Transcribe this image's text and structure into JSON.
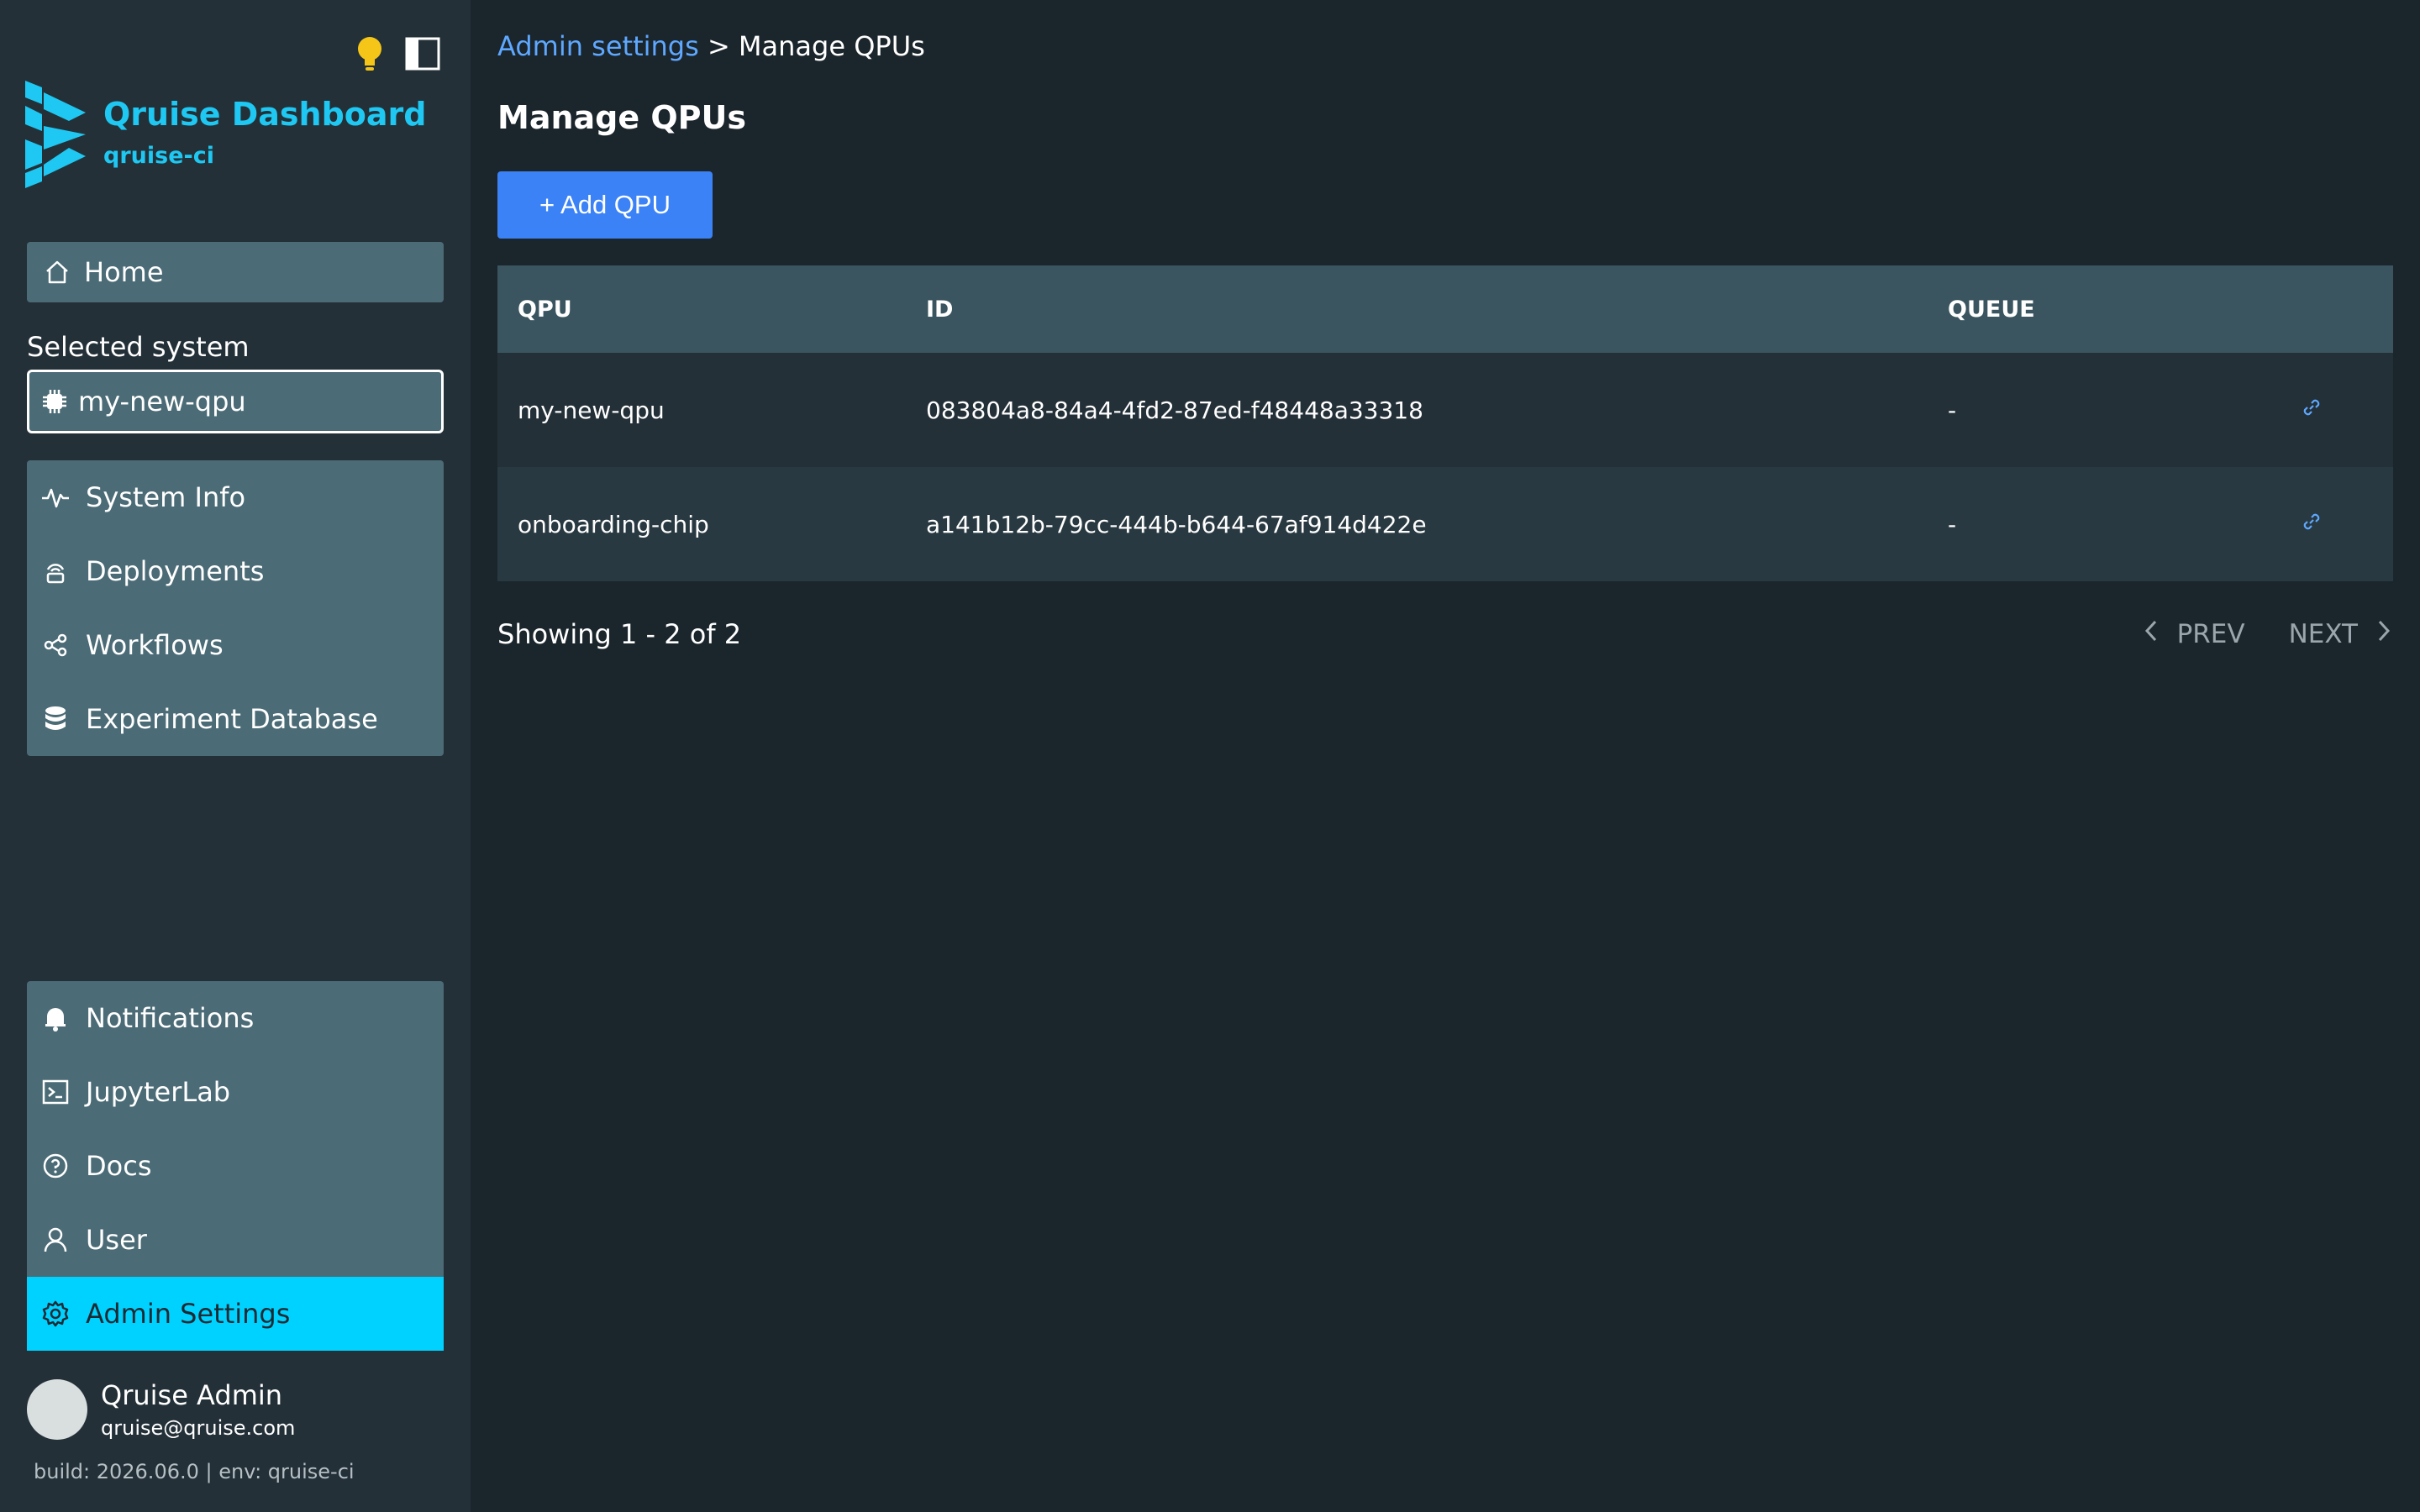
{
  "app": {
    "title": "Qruise Dashboard",
    "subtitle": "qruise-ci"
  },
  "sidebar": {
    "home_label": "Home",
    "selected_system_label": "Selected system",
    "selected_system_value": "my-new-qpu",
    "system_items": [
      {
        "label": "System Info",
        "icon": "activity-icon"
      },
      {
        "label": "Deployments",
        "icon": "deploy-icon"
      },
      {
        "label": "Workflows",
        "icon": "workflow-icon"
      },
      {
        "label": "Experiment Database",
        "icon": "database-icon"
      }
    ],
    "bottom_items": [
      {
        "label": "Notifications",
        "icon": "bell-icon"
      },
      {
        "label": "JupyterLab",
        "icon": "terminal-icon"
      },
      {
        "label": "Docs",
        "icon": "help-icon"
      },
      {
        "label": "User",
        "icon": "user-icon"
      },
      {
        "label": "Admin Settings",
        "icon": "gear-icon",
        "active": true
      }
    ],
    "user_name": "Qruise Admin",
    "user_email": "qruise@qruise.com",
    "build_info": "build: 2026.06.0 | env: qruise-ci"
  },
  "breadcrumb": {
    "parent": "Admin settings",
    "separator": ">",
    "current": "Manage QPUs"
  },
  "page": {
    "title": "Manage QPUs",
    "add_button": "+ Add QPU"
  },
  "table": {
    "headers": {
      "qpu": "QPU",
      "id": "ID",
      "queue": "QUEUE"
    },
    "rows": [
      {
        "qpu": "my-new-qpu",
        "id": "083804a8-84a4-4fd2-87ed-f48448a33318",
        "queue": "-"
      },
      {
        "qpu": "onboarding-chip",
        "id": "a141b12b-79cc-444b-b644-67af914d422e",
        "queue": "-"
      }
    ]
  },
  "pagination": {
    "showing": "Showing 1 - 2 of 2",
    "prev": "PREV",
    "next": "NEXT"
  },
  "colors": {
    "accent": "#1ec8f2",
    "active_nav": "#00d2ff",
    "primary_button": "#3b82f6",
    "link": "#5ea8ff",
    "lightbulb": "#f5c518"
  }
}
